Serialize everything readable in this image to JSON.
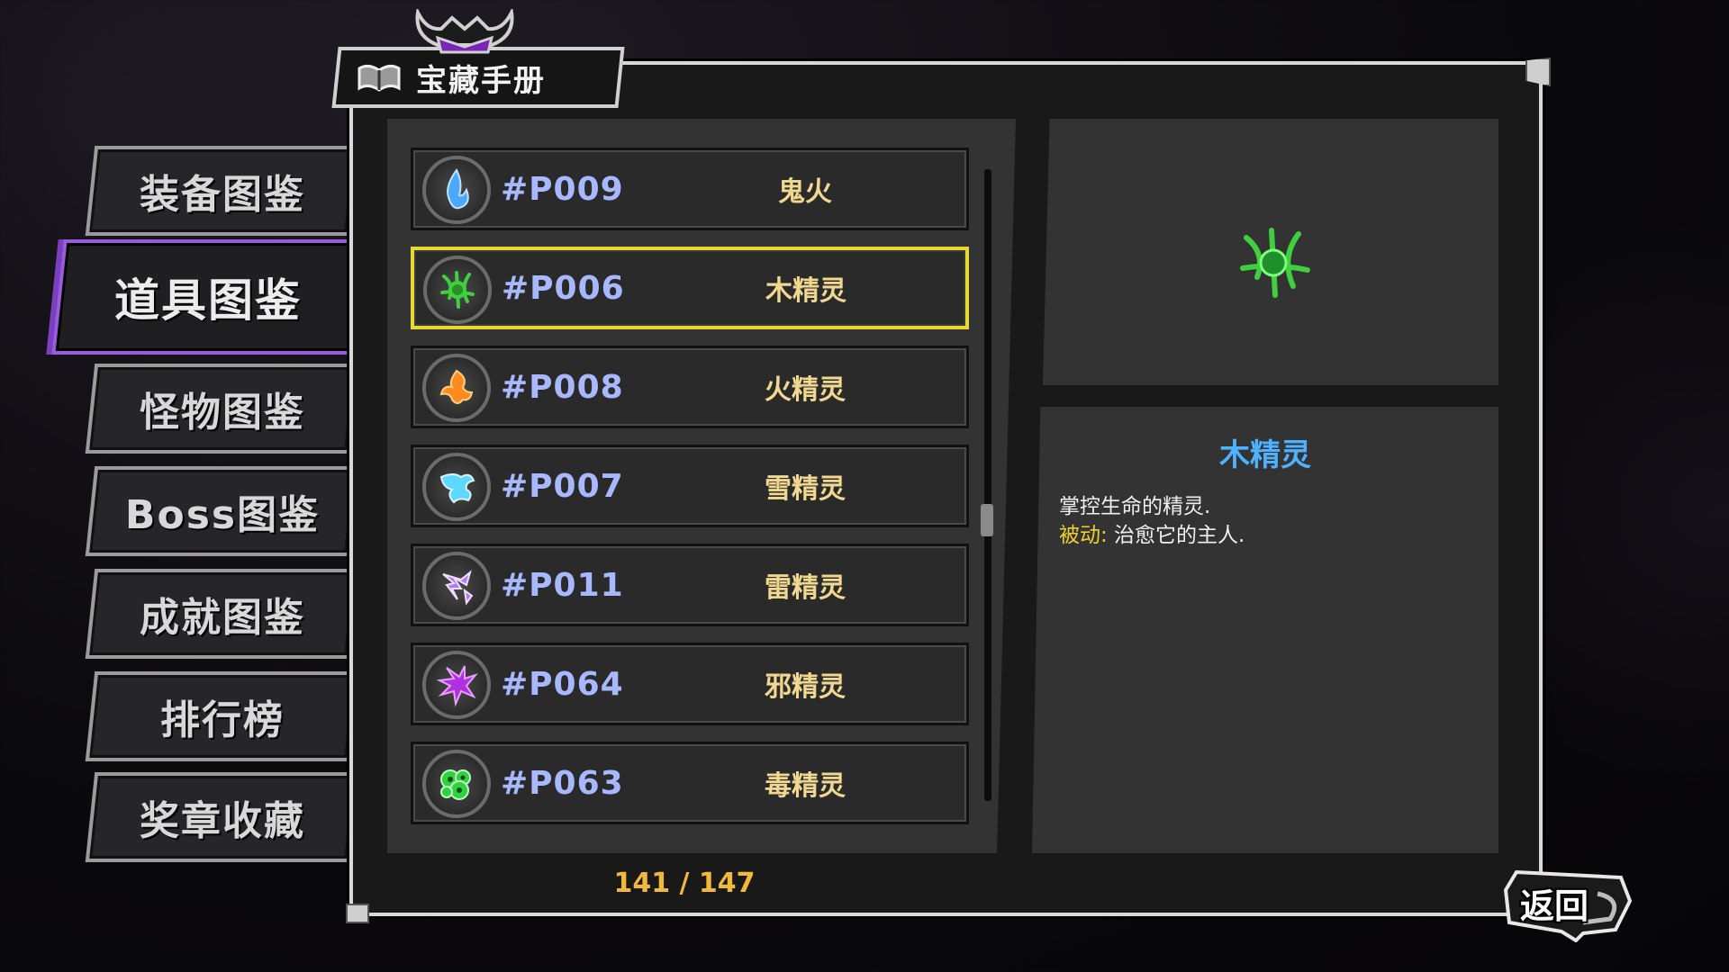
{
  "window": {
    "title": "宝藏手册"
  },
  "categories": [
    {
      "label": "装备图鉴",
      "active": false
    },
    {
      "label": "道具图鉴",
      "active": true
    },
    {
      "label": "怪物图鉴",
      "active": false
    },
    {
      "label": "Boss图鉴",
      "active": false
    },
    {
      "label": "成就图鉴",
      "active": false
    },
    {
      "label": "排行榜",
      "active": false
    },
    {
      "label": "奖章收藏",
      "active": false
    }
  ],
  "items": [
    {
      "code": "#P009",
      "name": "鬼火",
      "icon": "blue-flame-icon",
      "color": "#4aa8ff",
      "selected": false
    },
    {
      "code": "#P006",
      "name": "木精灵",
      "icon": "wood-spirit-icon",
      "color": "#3fcf3f",
      "selected": true
    },
    {
      "code": "#P008",
      "name": "火精灵",
      "icon": "fire-spirit-icon",
      "color": "#ff8a20",
      "selected": false
    },
    {
      "code": "#P007",
      "name": "雪精灵",
      "icon": "snow-spirit-icon",
      "color": "#5fd8ff",
      "selected": false
    },
    {
      "code": "#P011",
      "name": "雷精灵",
      "icon": "thunder-spirit-icon",
      "color": "#b07aff",
      "selected": false
    },
    {
      "code": "#P064",
      "name": "邪精灵",
      "icon": "evil-spirit-icon",
      "color": "#b030e0",
      "selected": false
    },
    {
      "code": "#P063",
      "name": "毒精灵",
      "icon": "poison-spirit-icon",
      "color": "#30d040",
      "selected": false
    }
  ],
  "pagination": {
    "text": "141 / 147"
  },
  "detail": {
    "name": "木精灵",
    "description": "掌控生命的精灵.",
    "passive_label": "被动:",
    "passive_text": " 治愈它的主人."
  },
  "return_button": {
    "label": "返回"
  },
  "colors": {
    "accent_purple": "#9a5be0",
    "selected_border": "#e8d832",
    "code_text": "#a8b8ff",
    "name_text": "#f0d890",
    "counter": "#f0b93a",
    "detail_title": "#4fb2ff"
  }
}
